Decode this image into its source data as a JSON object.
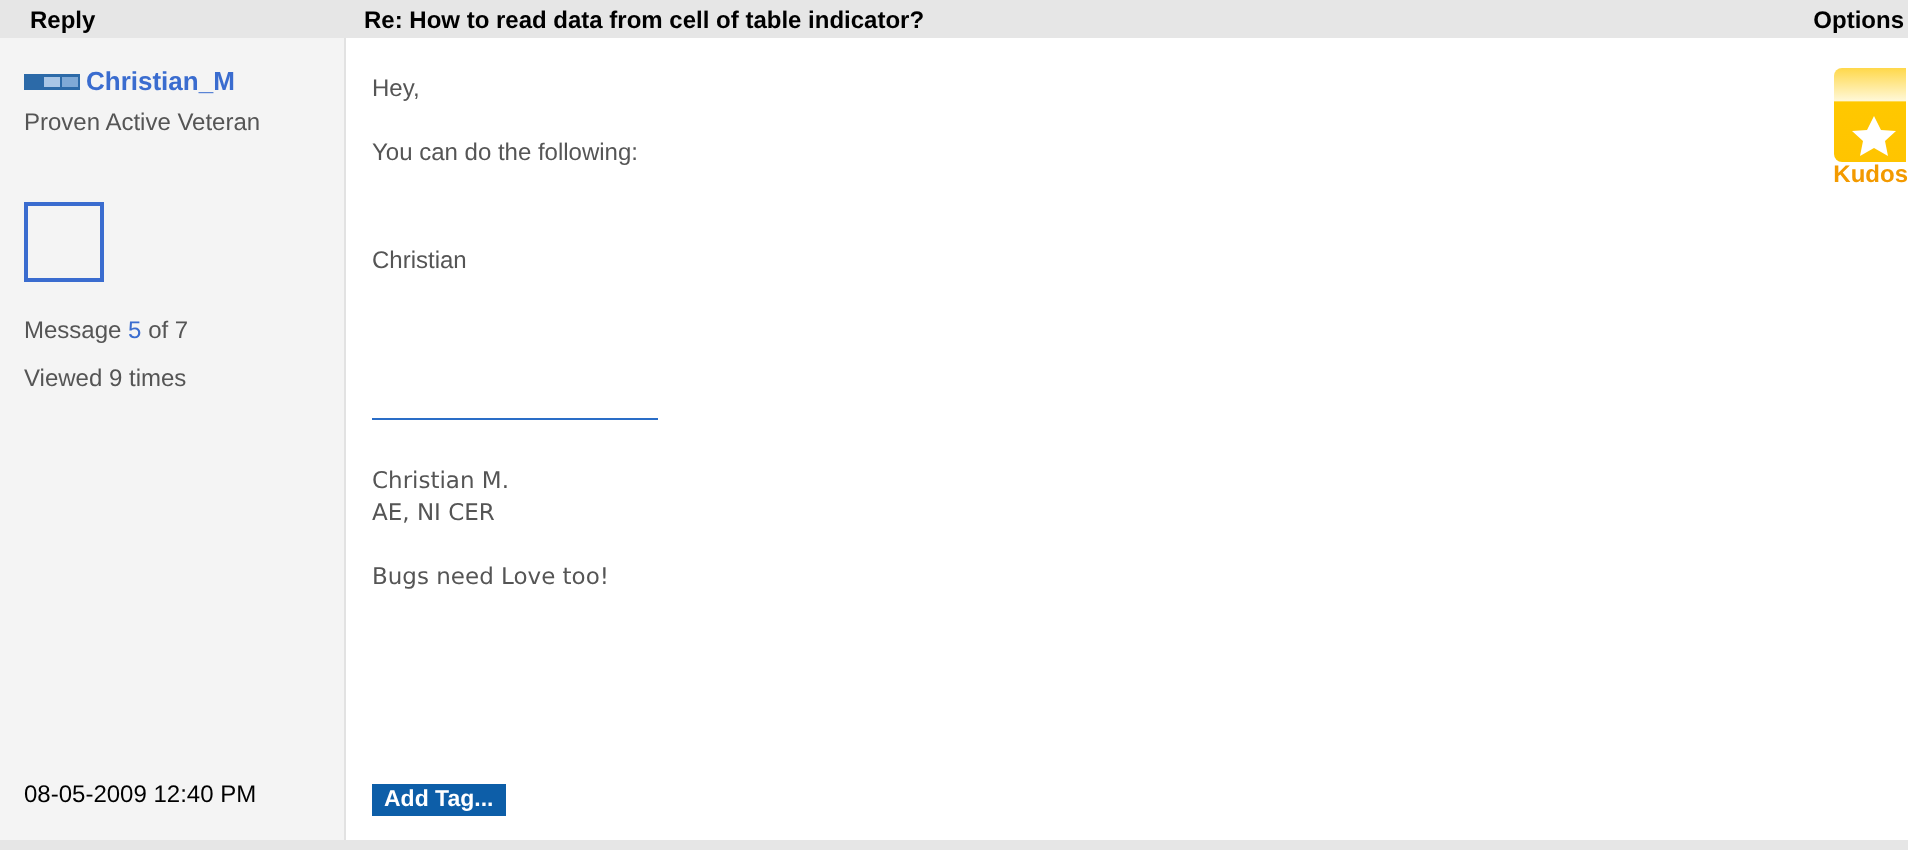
{
  "header": {
    "reply_label": "Reply",
    "subject": "Re: How to read data from cell of table indicator?",
    "options_label": "Options"
  },
  "author": {
    "name": "Christian_M",
    "rank": "Proven Active Veteran"
  },
  "message_count": {
    "prefix": "Message",
    "number": "5",
    "suffix": "of 7"
  },
  "views": "Viewed 9 times",
  "posted": "08-05-2009 12:40 PM",
  "body": [
    "Hey,",
    "You can do the following:",
    "Christian"
  ],
  "signature": [
    "Christian M.",
    "AE, NI CER",
    "Bugs need Love too!"
  ],
  "tag_button": "Add Tag...",
  "kudos_label": "Kudos"
}
